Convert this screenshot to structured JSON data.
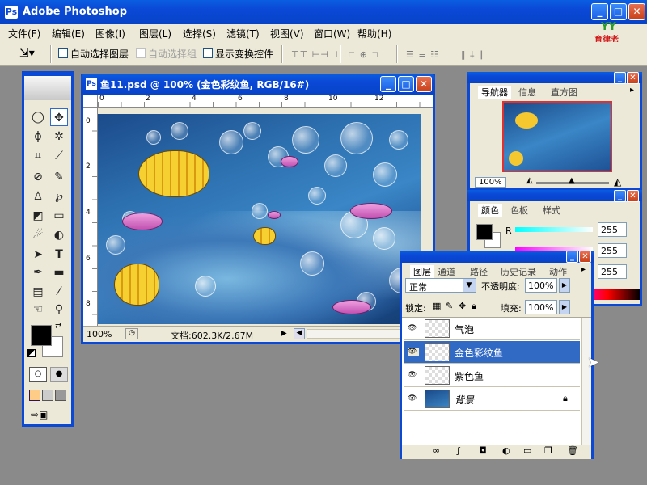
{
  "app": {
    "title": "Adobe Photoshop"
  },
  "menu": [
    "文件(F)",
    "编辑(E)",
    "图像(I)",
    "图层(L)",
    "选择(S)",
    "滤镜(T)",
    "视图(V)",
    "窗口(W)",
    "帮助(H)"
  ],
  "options": {
    "auto_select_layer": "自动选择图层",
    "auto_select_group": "自动选择组",
    "show_transform": "显示变换控件",
    "align_icons_1": "⊤⊤ ⊢⊣ ⊥⊥",
    "align_icons_2": "⊏ ⊕ ⊐",
    "align_icons_3": "☰ ≡ ☷",
    "align_icons_4": "‖ ‡ ∥"
  },
  "logo_text": "育律老",
  "document": {
    "title": "鱼11.psd @ 100% (金色彩纹鱼, RGB/16#)",
    "zoom": "100%",
    "doc_info": "文档:602.3K/2.67M",
    "ruler_h": [
      "0",
      "2",
      "4",
      "6",
      "8",
      "10",
      "12"
    ],
    "ruler_v": [
      "0",
      "2",
      "4",
      "6",
      "8"
    ]
  },
  "navigator": {
    "tabs": [
      "导航器",
      "信息",
      "直方图"
    ],
    "zoom": "100%"
  },
  "color_panel": {
    "tabs": [
      "颜色",
      "色板",
      "样式"
    ],
    "r_label": "R",
    "r_value": "255",
    "g_value": "255",
    "b_value": "255"
  },
  "layers_panel": {
    "tabs": [
      "图层",
      "通道",
      "路径",
      "历史记录",
      "动作"
    ],
    "blend_mode": "正常",
    "opacity_label": "不透明度:",
    "opacity": "100%",
    "lock_label": "锁定:",
    "fill_label": "填充:",
    "fill": "100%",
    "layers": [
      {
        "name": "气泡",
        "selected": false
      },
      {
        "name": "金色彩纹鱼",
        "selected": true
      },
      {
        "name": "紫色鱼",
        "selected": false
      },
      {
        "name": "背景",
        "selected": false,
        "locked": true
      }
    ]
  },
  "colors": {
    "title_bar": "#0a48d6",
    "selection": "#316ac5",
    "panel_bg": "#ece9d8"
  }
}
